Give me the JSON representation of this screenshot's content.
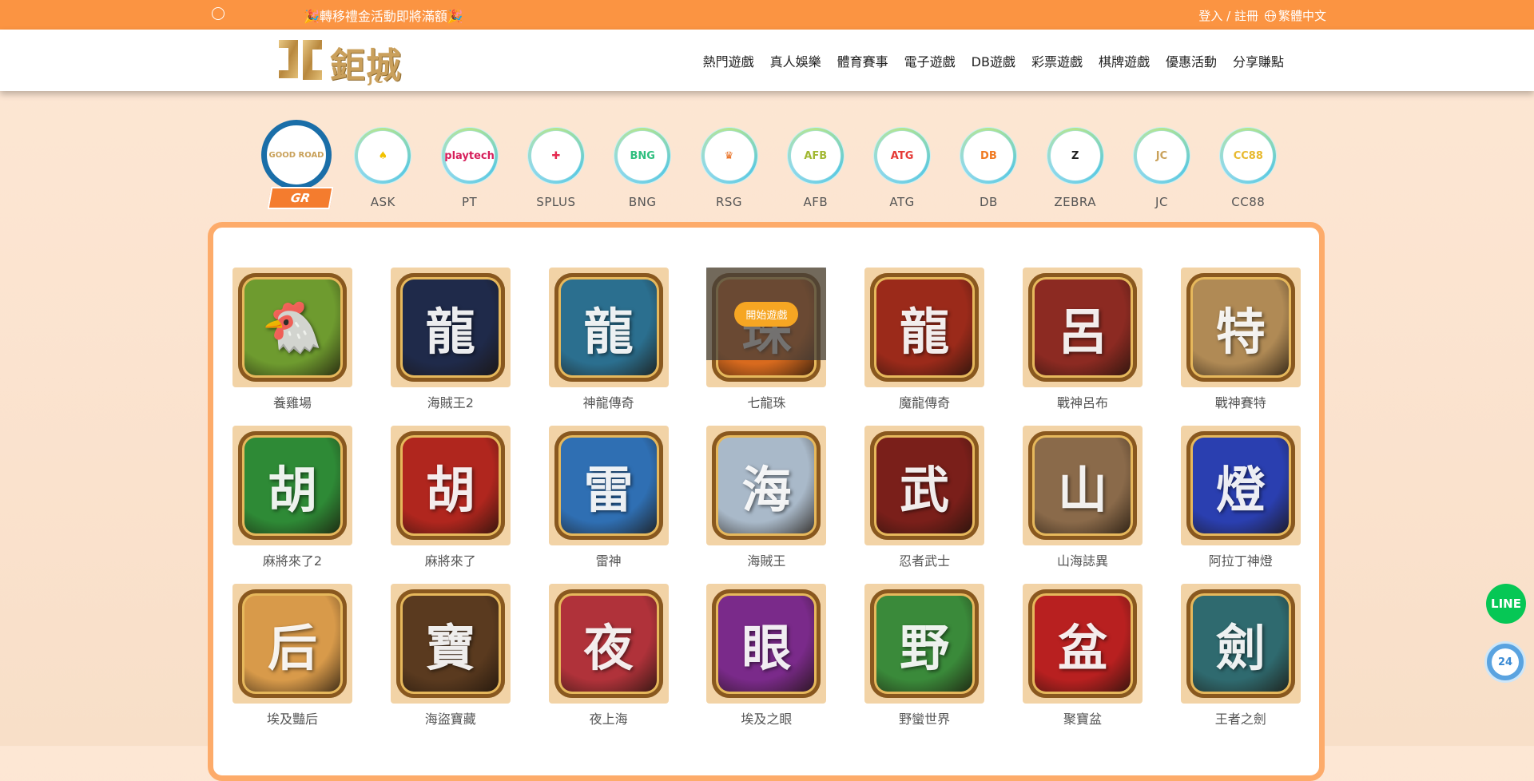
{
  "topbar": {
    "marquee": "🎉轉移禮金活動即將滿額🎉",
    "login_label": "登入 / 註冊",
    "language": "繁體中文"
  },
  "header": {
    "logo_text": "鉅城",
    "logo_sub": "JC",
    "nav": [
      "熱門遊戲",
      "真人娛樂",
      "體育賽事",
      "電子遊戲",
      "DB遊戲",
      "彩票遊戲",
      "棋牌遊戲",
      "優惠活動",
      "分享賺點"
    ]
  },
  "providers": [
    {
      "name": "GR",
      "logo": "GOOD ROAD",
      "color": "#c9a15a",
      "active": true
    },
    {
      "name": "ASK",
      "logo": "♠",
      "color": "#f2c200"
    },
    {
      "name": "PT",
      "logo": "playtech",
      "color": "#d61f5b"
    },
    {
      "name": "SPLUS",
      "logo": "✚",
      "color": "#e52b50"
    },
    {
      "name": "BNG",
      "logo": "BNG",
      "color": "#2fbf7f"
    },
    {
      "name": "RSG",
      "logo": "♛",
      "color": "#e86a1a"
    },
    {
      "name": "AFB",
      "logo": "AFB",
      "color": "#a2b833"
    },
    {
      "name": "ATG",
      "logo": "ATG",
      "color": "#e53935"
    },
    {
      "name": "DB",
      "logo": "DB",
      "color": "#f07a22"
    },
    {
      "name": "ZEBRA",
      "logo": "Z",
      "color": "#222222"
    },
    {
      "name": "JC",
      "logo": "JC",
      "color": "#c9a15a"
    },
    {
      "name": "CC88",
      "logo": "CC88",
      "color": "#e8b92e"
    }
  ],
  "games": [
    {
      "title": "養雞場",
      "glyph": "🐔",
      "bg": "#6e9b2f"
    },
    {
      "title": "海賊王2",
      "glyph": "龍",
      "bg": "#1f2a4a"
    },
    {
      "title": "神龍傳奇",
      "glyph": "龍",
      "bg": "#2b6f8f"
    },
    {
      "title": "七龍珠",
      "glyph": "珠",
      "bg": "#d86a1e",
      "hover_label": "開始遊戲"
    },
    {
      "title": "魔龍傳奇",
      "glyph": "龍",
      "bg": "#9b2a1a"
    },
    {
      "title": "戰神呂布",
      "glyph": "呂",
      "bg": "#8c2a22"
    },
    {
      "title": "戰神賽特",
      "glyph": "特",
      "bg": "#b08a55"
    },
    {
      "title": "麻將來了2",
      "glyph": "胡",
      "bg": "#2e8a36"
    },
    {
      "title": "麻將來了",
      "glyph": "胡",
      "bg": "#b0261e"
    },
    {
      "title": "雷神",
      "glyph": "雷",
      "bg": "#2f6fb3"
    },
    {
      "title": "海賊王",
      "glyph": "海",
      "bg": "#a9b9c9"
    },
    {
      "title": "忍者武士",
      "glyph": "武",
      "bg": "#7a1f1a"
    },
    {
      "title": "山海誌異",
      "glyph": "山",
      "bg": "#8a6a4a"
    },
    {
      "title": "阿拉丁神燈",
      "glyph": "燈",
      "bg": "#2a3fb0"
    },
    {
      "title": "埃及豔后",
      "glyph": "后",
      "bg": "#d89a4a"
    },
    {
      "title": "海盜寶藏",
      "glyph": "寶",
      "bg": "#5a3a1f"
    },
    {
      "title": "夜上海",
      "glyph": "夜",
      "bg": "#b0323a"
    },
    {
      "title": "埃及之眼",
      "glyph": "眼",
      "bg": "#7a2a8a"
    },
    {
      "title": "野蠻世界",
      "glyph": "野",
      "bg": "#3a8a3a"
    },
    {
      "title": "聚寶盆",
      "glyph": "盆",
      "bg": "#b82020"
    },
    {
      "title": "王者之劍",
      "glyph": "劍",
      "bg": "#2f6a6f"
    }
  ],
  "floating": {
    "line_label": "LINE",
    "support_label": "24"
  }
}
